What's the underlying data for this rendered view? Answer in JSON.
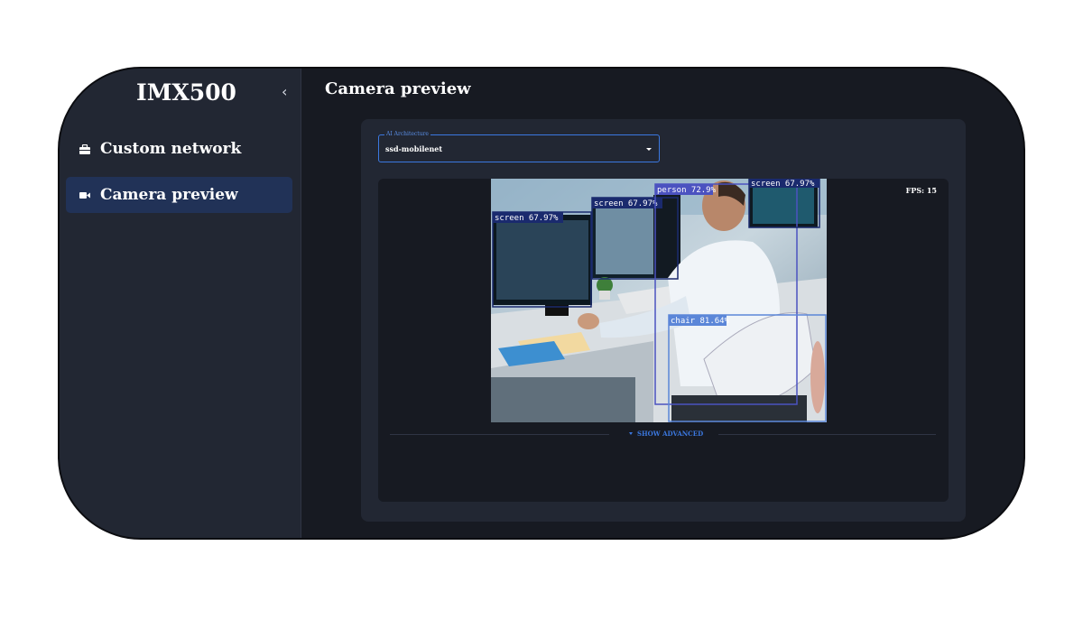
{
  "app": {
    "brand": "IMX500",
    "collapse_icon": "chevron-left-icon"
  },
  "sidebar": {
    "items": [
      {
        "label": "Custom network",
        "icon": "briefcase-icon",
        "active": false
      },
      {
        "label": "Camera preview",
        "icon": "videocam-icon",
        "active": true
      }
    ]
  },
  "main": {
    "title": "Camera preview",
    "architecture": {
      "legend": "AI Architecture",
      "value": "ssd-mobilenet"
    },
    "preview": {
      "fps": "FPS: 15",
      "detections": [
        {
          "label": "screen",
          "score": "67.97%",
          "color": "#1a2a6e"
        },
        {
          "label": "screen",
          "score": "67.97%",
          "color": "#1a2a6e"
        },
        {
          "label": "person",
          "score": "72.9%",
          "color": "#4b52c0"
        },
        {
          "label": "screen",
          "score": "67.97%",
          "color": "#1a2a6e"
        },
        {
          "label": "chair",
          "score": "81.64%",
          "color": "#5b86d8"
        }
      ]
    },
    "advanced_toggle": "SHOW ADVANCED"
  },
  "colors": {
    "accent": "#3b78e0",
    "active_nav": "#213257",
    "panel": "#222733",
    "background": "#171a22"
  }
}
